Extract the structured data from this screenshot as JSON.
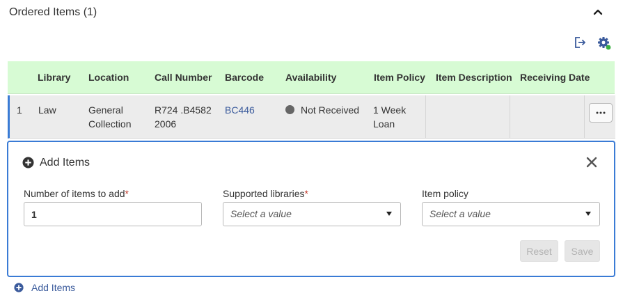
{
  "section": {
    "title": "Ordered Items (1)"
  },
  "toolbar": {
    "export_icon": "export-icon",
    "settings_icon": "gear-icon",
    "settings_status_color": "#3cb043"
  },
  "table": {
    "header_bg": "#d7fbd4",
    "columns": [
      "Library",
      "Location",
      "Call Number",
      "Barcode",
      "Availability",
      "Item Policy",
      "Item Description",
      "Receiving Date"
    ],
    "rows": [
      {
        "index": "1",
        "library": "Law",
        "location_line1": "General",
        "location_line2": "Collection",
        "call_number_line1": "R724 .B4582",
        "call_number_line2": "2006",
        "barcode": "BC446",
        "availability": "Not Received",
        "item_policy_line1": "1 Week",
        "item_policy_line2": "Loan",
        "item_description": "",
        "receiving_date": ""
      }
    ]
  },
  "add_panel": {
    "title": "Add Items",
    "accent_color": "#3a7bd5",
    "fields": {
      "count_label": "Number of items to add",
      "count_value": "1",
      "libraries_label": "Supported libraries",
      "libraries_placeholder": "Select a value",
      "policy_label": "Item policy",
      "policy_placeholder": "Select a value"
    },
    "required_marker": "*",
    "reset_label": "Reset",
    "save_label": "Save"
  },
  "footer": {
    "add_items_label": "Add Items"
  }
}
